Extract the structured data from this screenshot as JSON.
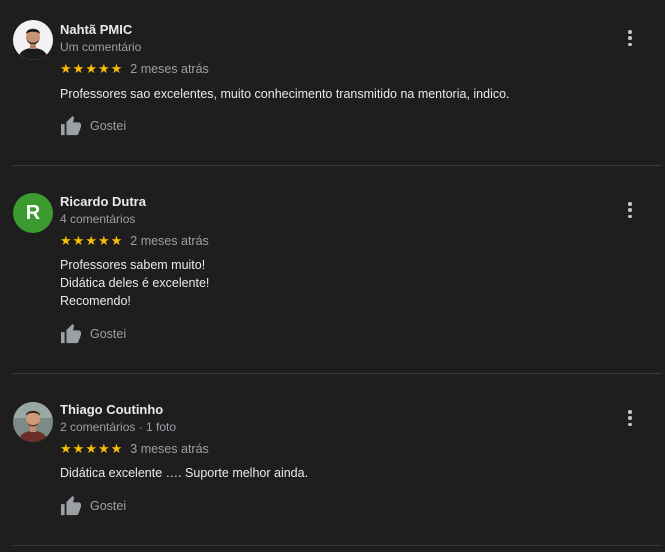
{
  "reviews": [
    {
      "author": "Nahtã PMIC",
      "meta": "Um comentário",
      "rating": 5,
      "date": "2 meses atrás",
      "text_lines": [
        "Professores sao excelentes, muito conhecimento transmitido na mentoria, indico."
      ],
      "like_label": "Gostei",
      "avatar_type": "photo"
    },
    {
      "author": "Ricardo Dutra",
      "meta": "4 comentários",
      "rating": 5,
      "date": "2 meses atrás",
      "text_lines": [
        "Professores sabem muito!",
        "Didática deles é excelente!",
        "Recomendo!"
      ],
      "like_label": "Gostei",
      "avatar_type": "letter",
      "avatar_letter": "R",
      "avatar_color": "#3c9b2f"
    },
    {
      "author": "Thiago Coutinho",
      "meta": "2 comentários · 1 foto",
      "rating": 5,
      "date": "3 meses atrás",
      "text_lines": [
        "Didática excelente …. Suporte melhor ainda."
      ],
      "like_label": "Gostei",
      "avatar_type": "photo"
    }
  ],
  "icons": {
    "star": "star-icon",
    "like": "thumbs-up-icon",
    "more": "more-options-icon"
  },
  "colors": {
    "background": "#1e1e1e",
    "star": "#fbbc04",
    "text": "#e8eaed",
    "secondary_text": "#9aa0a6"
  }
}
